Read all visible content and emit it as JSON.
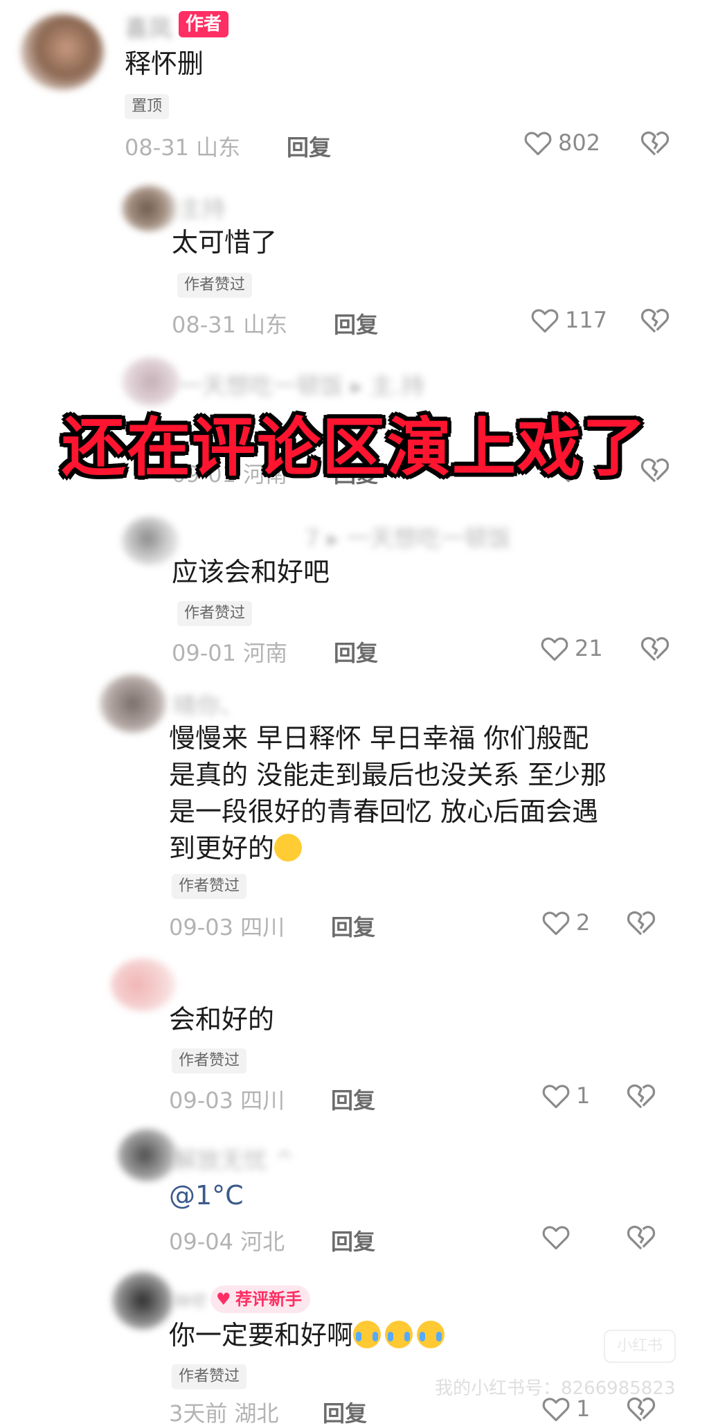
{
  "overlay_title": "还在评论区演上戏了",
  "watermark": "我的小红书号：8266985823",
  "watermark_logo": "小红书",
  "comments": [
    {
      "nickname": "喜凤",
      "tag": "作者",
      "text": "释怀删",
      "badge": "置顶",
      "date": "08-31 山东",
      "reply": "回复",
      "likes": "802"
    },
    {
      "nickname": "主持",
      "text": "太可惜了",
      "badge": "作者赞过",
      "date": "08-31 山东",
      "reply": "回复",
      "likes": "117"
    },
    {
      "nickname": "一天想吃一顿饭 ▸ 主.持",
      "text": "",
      "date": "09-01 河南",
      "reply": "回复",
      "likes": ""
    },
    {
      "nickname": "7 ▸ 一天想吃一顿饭",
      "text": "应该会和好吧",
      "badge": "作者赞过",
      "date": "09-01 河南",
      "reply": "回复",
      "likes": "21"
    },
    {
      "nickname": "晴你、",
      "text": "慢慢来 早日释怀 早日幸福 你们般配\n是真的 没能走到最后也没关系 至少那\n是一段很好的青春回忆 放心后面会遇\n到更好的",
      "badge": "作者赞过",
      "date": "09-03 四川",
      "reply": "回复",
      "likes": "2"
    },
    {
      "nickname": "",
      "text": "会和好的",
      "badge": "作者赞过",
      "date": "09-03 四川",
      "reply": "回复",
      "likes": "1"
    },
    {
      "nickname": "解放无忧 ^",
      "text": "@1°C",
      "date": "09-04 河北",
      "reply": "回复",
      "likes": ""
    },
    {
      "nickname": "we",
      "tag": "荐评新手",
      "text": "你一定要和好啊",
      "badge": "作者赞过",
      "date": "3天前 湖北",
      "reply": "回复",
      "likes": "1"
    }
  ]
}
